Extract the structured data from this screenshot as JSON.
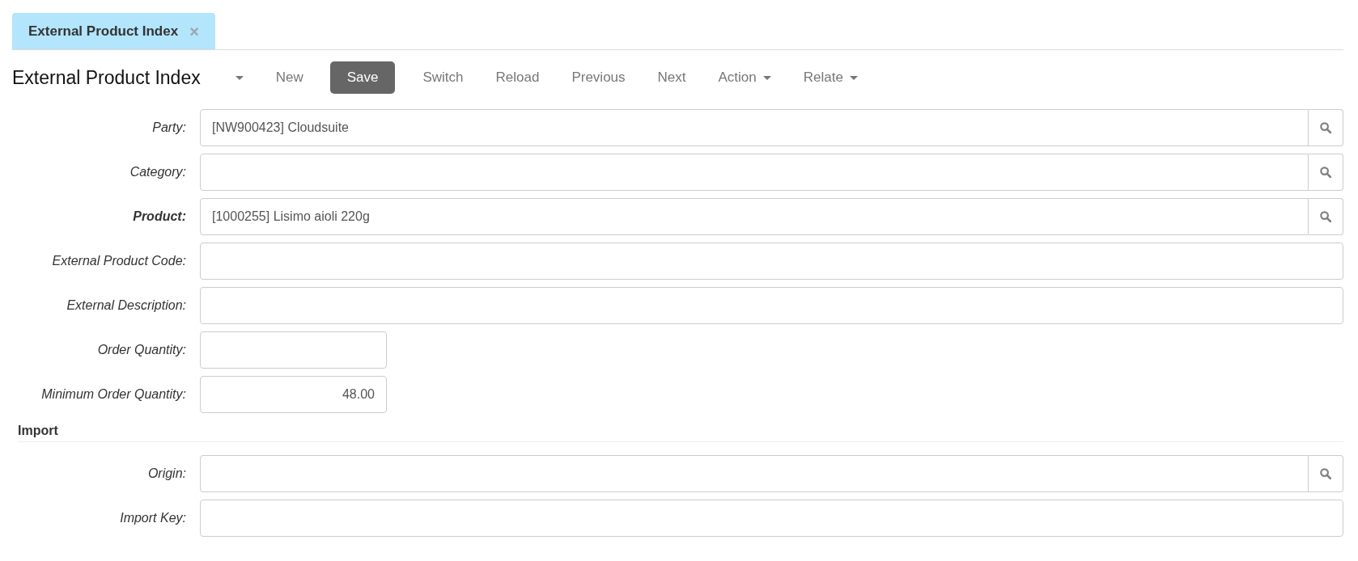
{
  "tabs": [
    {
      "label": "External Product Index",
      "close": "×",
      "selected": true
    }
  ],
  "toolbar": {
    "title": "External Product Index",
    "buttons": [
      {
        "label": "New",
        "kind": "plain"
      },
      {
        "label": "Save",
        "kind": "primary"
      },
      {
        "label": "Switch",
        "kind": "plain"
      },
      {
        "label": "Reload",
        "kind": "plain"
      },
      {
        "label": "Previous",
        "kind": "plain"
      },
      {
        "label": "Next",
        "kind": "plain"
      },
      {
        "label": "Action",
        "kind": "dropdown"
      },
      {
        "label": "Relate",
        "kind": "dropdown"
      }
    ]
  },
  "sections": [
    {
      "fields": [
        {
          "label": "Party:",
          "kind": "lookup",
          "required": false,
          "value": "[NW900423] Cloudsuite"
        },
        {
          "label": "Category:",
          "kind": "lookup",
          "required": false
        },
        {
          "label": "Product:",
          "kind": "lookup",
          "required": true,
          "value": "[1000255] Lisimo aioli 220g"
        },
        {
          "label": "External Product Code:",
          "kind": "text",
          "required": false
        },
        {
          "label": "External Description:",
          "kind": "text",
          "required": false
        },
        {
          "label": "Order Quantity:",
          "kind": "number",
          "required": false
        },
        {
          "label": "Minimum Order Quantity:",
          "kind": "number",
          "required": false,
          "value": "48.00"
        }
      ]
    },
    {
      "title": "Import",
      "fields": [
        {
          "label": "Origin:",
          "kind": "lookup",
          "required": false
        },
        {
          "label": "Import Key:",
          "kind": "text",
          "required": false
        }
      ]
    }
  ]
}
